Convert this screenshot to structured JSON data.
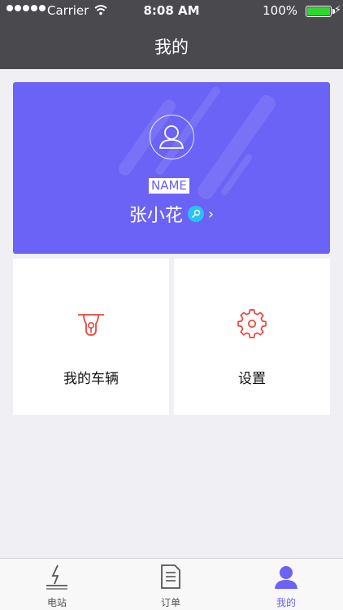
{
  "status_bar": {
    "carrier": "Carrier",
    "time": "8:08 AM",
    "battery": "100%"
  },
  "nav": {
    "title": "我的"
  },
  "profile": {
    "name_tag": "NAME",
    "username": "张小花",
    "chevron": "›",
    "accent_color": "#6b63f5",
    "badge_color": "#29c2f5"
  },
  "tiles": [
    {
      "label": "我的车辆",
      "icon": "scooter-icon"
    },
    {
      "label": "设置",
      "icon": "gear-icon"
    }
  ],
  "tabbar": {
    "items": [
      {
        "label": "电站",
        "icon": "charging-station-icon"
      },
      {
        "label": "订单",
        "icon": "order-document-icon"
      },
      {
        "label": "我的",
        "icon": "user-icon",
        "active": true
      }
    ],
    "active_color": "#6b63f5"
  }
}
